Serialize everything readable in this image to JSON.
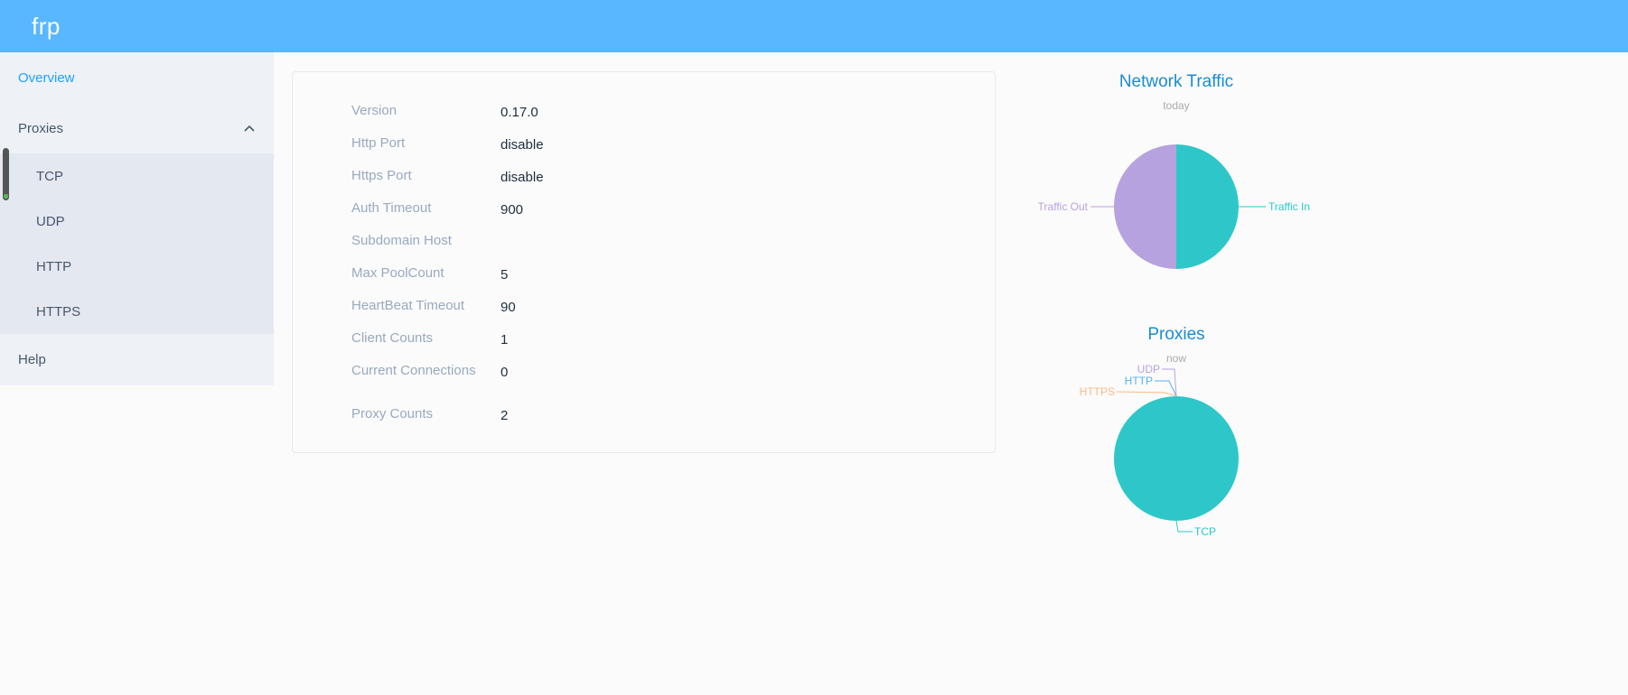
{
  "header": {
    "brand": "frp"
  },
  "sidebar": {
    "overview": "Overview",
    "proxies": "Proxies",
    "proxy_items": [
      "TCP",
      "UDP",
      "HTTP",
      "HTTPS"
    ],
    "help": "Help"
  },
  "info": {
    "rows": [
      {
        "label": "Version",
        "value": "0.17.0"
      },
      {
        "label": "Http Port",
        "value": "disable"
      },
      {
        "label": "Https Port",
        "value": "disable"
      },
      {
        "label": "Auth Timeout",
        "value": "900"
      },
      {
        "label": "Subdomain Host",
        "value": ""
      },
      {
        "label": "Max PoolCount",
        "value": "5"
      },
      {
        "label": "HeartBeat Timeout",
        "value": "90"
      },
      {
        "label": "Client Counts",
        "value": "1"
      },
      {
        "label": "Current Connections",
        "value": "0"
      },
      {
        "label": "Proxy Counts",
        "value": "2"
      }
    ]
  },
  "colors": {
    "header": "#58b7ff",
    "accent": "#20a0ff",
    "teal": "#2ec7c9",
    "purple": "#b6a2de",
    "blue": "#5ab1ef",
    "orange": "#ffb980"
  },
  "chart_data": [
    {
      "type": "pie",
      "title": "Network Traffic",
      "subtitle": "today",
      "slices": [
        {
          "name": "Traffic In",
          "value": 50
        },
        {
          "name": "Traffic Out",
          "value": 50
        }
      ]
    },
    {
      "type": "pie",
      "title": "Proxies",
      "subtitle": "now",
      "slices": [
        {
          "name": "TCP",
          "value": 2
        },
        {
          "name": "UDP",
          "value": 0
        },
        {
          "name": "HTTP",
          "value": 0
        },
        {
          "name": "HTTPS",
          "value": 0
        }
      ]
    }
  ]
}
